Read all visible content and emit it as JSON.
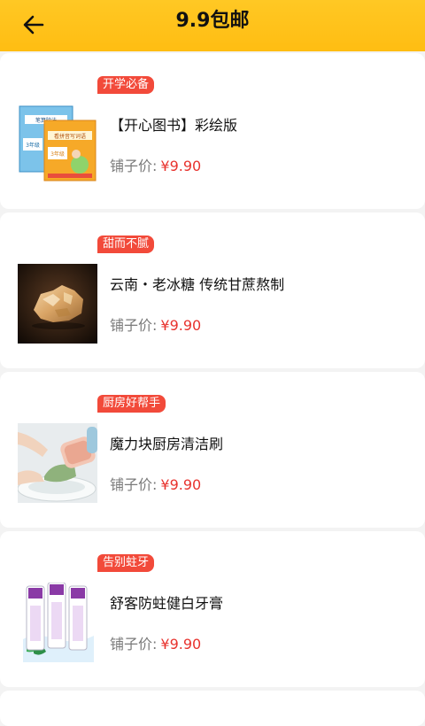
{
  "header": {
    "title": "9.9包邮",
    "back_icon": "arrow-left-icon",
    "bg_color": "#ffbd12"
  },
  "colors": {
    "tag_bg": "#f24a3a",
    "price": "#e8332e"
  },
  "products": [
    {
      "tag": "开学必备",
      "title": "【开心图书】彩绘版",
      "price_label": "铺子价:",
      "price": "¥9.90",
      "image": "childrens-books-image",
      "image_text_1": "笔算除法",
      "image_text_2": "看拼音写词语",
      "image_text_3": "3年级",
      "image_text_4": "3年级"
    },
    {
      "tag": "甜而不腻",
      "title": "云南・老冰糖 传统甘蔗熬制",
      "price_label": "铺子价:",
      "price": "¥9.90",
      "image": "rock-sugar-image"
    },
    {
      "tag": "厨房好帮手",
      "title": "魔力块厨房清洁刷",
      "price_label": "铺子价:",
      "price": "¥9.90",
      "image": "kitchen-brush-image"
    },
    {
      "tag": "告别蛀牙",
      "title": "舒客防蛀健白牙膏",
      "price_label": "铺子价:",
      "price": "¥9.90",
      "image": "toothpaste-image"
    }
  ]
}
